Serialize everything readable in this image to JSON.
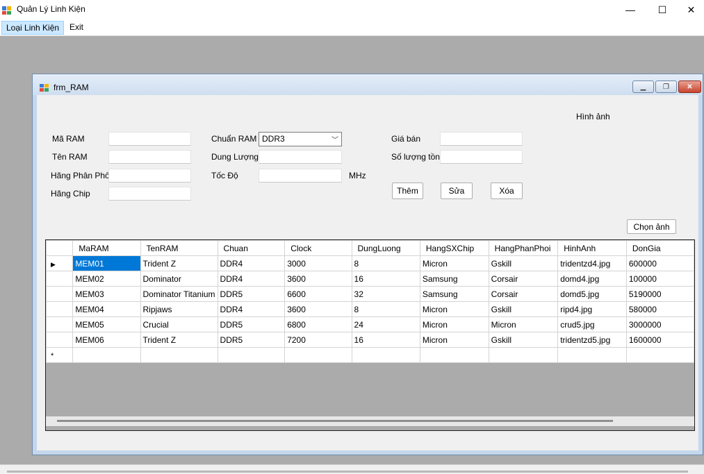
{
  "window": {
    "title": "Quản Lý Linh Kiện",
    "min_glyph": "—",
    "max_glyph": "☐",
    "close_glyph": "✕"
  },
  "menu": {
    "items": [
      "Loại Linh Kiện",
      "Exit"
    ]
  },
  "form": {
    "title": "frm_RAM",
    "labels": {
      "ma_ram": "Mã RAM",
      "ten_ram": "Tên RAM",
      "hang_phan_phoi": "Hãng Phân Phối",
      "hang_chip": "Hãng Chip",
      "chuan_ram": "Chuẩn RAM",
      "dung_luong": "Dung Lượng",
      "toc_do": "Tốc Độ",
      "mhz": "MHz",
      "gia_ban": "Giá bán",
      "so_luong_ton": "Số lượng tồn",
      "hinh_anh": "Hình ảnh"
    },
    "chuan_ram_value": "DDR3",
    "buttons": {
      "them": "Thêm",
      "sua": "Sửa",
      "xoa": "Xóa",
      "chon_anh": "Chọn ảnh"
    }
  },
  "grid": {
    "columns": [
      "MaRAM",
      "TenRAM",
      "Chuan",
      "Clock",
      "DungLuong",
      "HangSXChip",
      "HangPhanPhoi",
      "HinhAnh",
      "DonGia"
    ],
    "rows": [
      [
        "MEM01",
        "Trident Z",
        "DDR4",
        "3000",
        "8",
        "Micron",
        "Gskill",
        "tridentzd4.jpg",
        "600000"
      ],
      [
        "MEM02",
        "Dominator",
        "DDR4",
        "3600",
        "16",
        "Samsung",
        "Corsair",
        "domd4.jpg",
        "100000"
      ],
      [
        "MEM03",
        "Dominator Titanium",
        "DDR5",
        "6600",
        "32",
        "Samsung",
        "Corsair",
        "domd5.jpg",
        "5190000"
      ],
      [
        "MEM04",
        "Ripjaws",
        "DDR4",
        "3600",
        "8",
        "Micron",
        "Gskill",
        "ripd4.jpg",
        "580000"
      ],
      [
        "MEM05",
        "Crucial",
        "DDR5",
        "6800",
        "24",
        "Micron",
        "Micron",
        "crud5.jpg",
        "3000000"
      ],
      [
        "MEM06",
        "Trident Z",
        "DDR5",
        "7200",
        "16",
        "Micron",
        "Gskill",
        "tridentzd5.jpg",
        "1600000"
      ]
    ],
    "current_row_indicator": "▶",
    "new_row_indicator": "*"
  }
}
